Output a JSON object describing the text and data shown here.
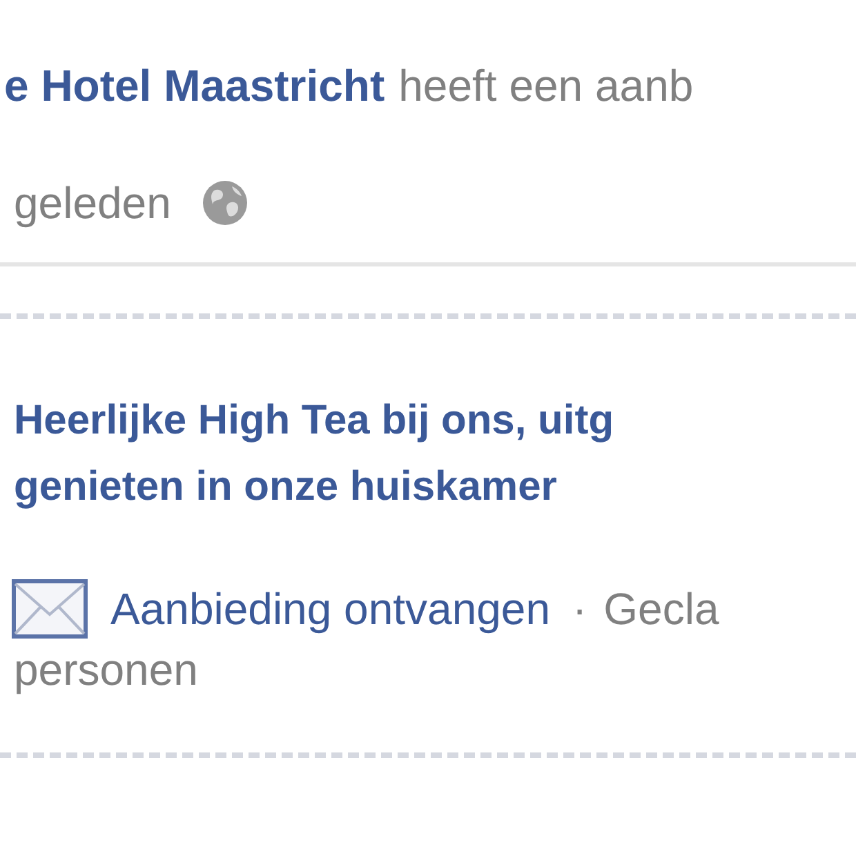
{
  "story": {
    "page_name": "e Hotel Maastricht",
    "action": "heeft een aanb",
    "time": "geleden",
    "public": true
  },
  "offer": {
    "title_lines": [
      "Heerlijke High Tea bij ons, uitg",
      "genieten in onze huiskamer"
    ],
    "claim_link": "Aanbieding ontvangen",
    "separator": "·",
    "claimed_start": "Gecla",
    "claimed_end": "personen"
  }
}
